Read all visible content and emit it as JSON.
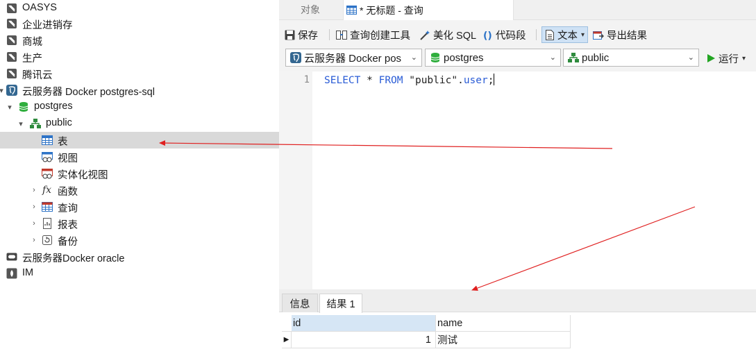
{
  "tree": {
    "connections": [
      {
        "label": "OASYS",
        "icon": "server-icon"
      },
      {
        "label": "企业进销存",
        "icon": "server-icon"
      },
      {
        "label": "商城",
        "icon": "server-icon"
      },
      {
        "label": "生产",
        "icon": "server-icon"
      },
      {
        "label": "腾讯云",
        "icon": "server-icon"
      },
      {
        "label": "云服务器 Docker postgres-sql",
        "icon": "postgres-icon"
      }
    ],
    "database": "postgres",
    "schema": "public",
    "schema_items": [
      {
        "label": "表",
        "icon": "table-icon",
        "selected": true
      },
      {
        "label": "视图",
        "icon": "view-icon"
      },
      {
        "label": "实体化视图",
        "icon": "materialized-view-icon"
      },
      {
        "label": "函数",
        "icon": "function-icon"
      },
      {
        "label": "查询",
        "icon": "query-icon"
      },
      {
        "label": "报表",
        "icon": "report-icon"
      },
      {
        "label": "备份",
        "icon": "backup-icon"
      }
    ],
    "other_connections": [
      {
        "label": "云服务器Docker oracle",
        "icon": "oracle-icon"
      },
      {
        "label": "IM",
        "icon": "mysql-icon"
      }
    ]
  },
  "tabs": {
    "objects": "对象",
    "query": "* 无标题 - 查询"
  },
  "toolbar": {
    "save": "保存",
    "query_builder": "查询创建工具",
    "beautify": "美化 SQL",
    "snippet": "代码段",
    "text": "文本",
    "export": "导出结果"
  },
  "selectors": {
    "connection": "云服务器 Docker pos",
    "database": "postgres",
    "schema": "public",
    "run": "运行"
  },
  "editor": {
    "line_number": "1",
    "kw_select": "SELECT",
    "star": " * ",
    "kw_from": "FROM",
    "table_schema": " \"public\".",
    "table_name": "user",
    "terminator": ";"
  },
  "result": {
    "tab_info": "信息",
    "tab_result": "结果 1",
    "columns": [
      "id",
      "name"
    ],
    "rows": [
      [
        "1",
        "测试"
      ]
    ]
  },
  "colors": {
    "selection": "#d9d9d9",
    "keyword": "#2a5cd6",
    "arrow": "#e02020",
    "run_green": "#22a522"
  }
}
